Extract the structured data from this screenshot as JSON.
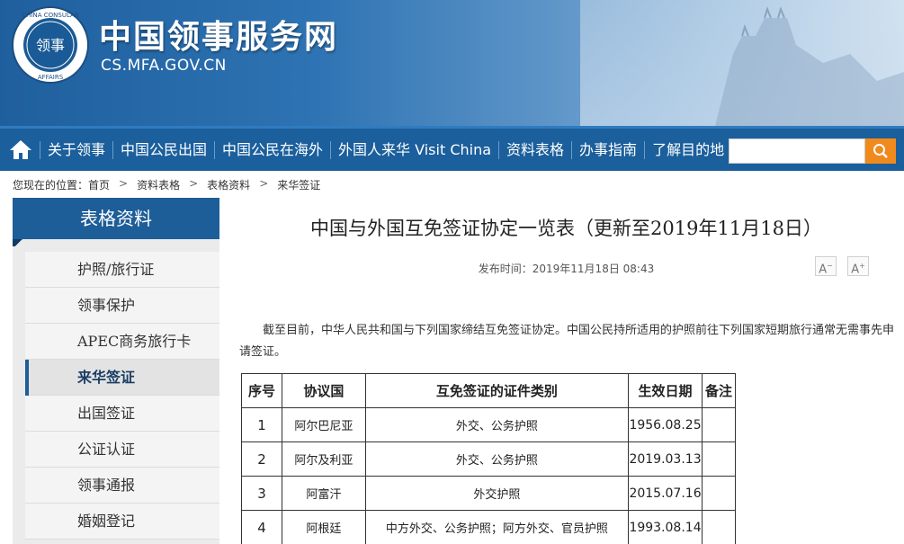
{
  "header": {
    "site_title": "中国领事服务网",
    "site_url": "CS.MFA.GOV.CN",
    "seal_text": "CHINA CONSULAR AFFAIRS 领事"
  },
  "nav": {
    "home_icon": "home-icon",
    "items": [
      "关于领事",
      "中国公民出国",
      "中国公民在海外",
      "外国人来华 Visit China",
      "资料表格",
      "办事指南",
      "了解目的地"
    ],
    "search_placeholder": "",
    "accent_color": "#f08a1c"
  },
  "breadcrumb": {
    "prefix": "您现在的位置：",
    "items": [
      "首页",
      "资料表格",
      "表格资料",
      "来华签证"
    ],
    "separator": ">"
  },
  "sidebar": {
    "title": "表格资料",
    "items": [
      {
        "label": "护照/旅行证",
        "active": false
      },
      {
        "label": "领事保护",
        "active": false
      },
      {
        "label": "APEC商务旅行卡",
        "active": false
      },
      {
        "label": "来华签证",
        "active": true
      },
      {
        "label": "出国签证",
        "active": false
      },
      {
        "label": "公证认证",
        "active": false
      },
      {
        "label": "领事通报",
        "active": false
      },
      {
        "label": "婚姻登记",
        "active": false
      }
    ]
  },
  "article": {
    "title": "中国与外国互免签证协定一览表（更新至2019年11月18日）",
    "published": "发布时间：2019年11月18日 08:43",
    "font_smaller": "A",
    "font_larger": "A",
    "intro": "截至目前，中华人民共和国与下列国家缔结互免签证协定。中国公民持所适用的护照前往下列国家短期旅行通常无需事先申请签证。",
    "table": {
      "headers": [
        "序号",
        "协议国",
        "互免签证的证件类别",
        "生效日期",
        "备注"
      ],
      "rows": [
        [
          "1",
          "阿尔巴尼亚",
          "外交、公务护照",
          "1956.08.25",
          ""
        ],
        [
          "2",
          "阿尔及利亚",
          "外交、公务护照",
          "2019.03.13",
          ""
        ],
        [
          "3",
          "阿富汗",
          "外交护照",
          "2015.07.16",
          ""
        ],
        [
          "4",
          "阿根廷",
          "中方外交、公务护照；阿方外交、官员护照",
          "1993.08.14",
          ""
        ]
      ]
    }
  }
}
